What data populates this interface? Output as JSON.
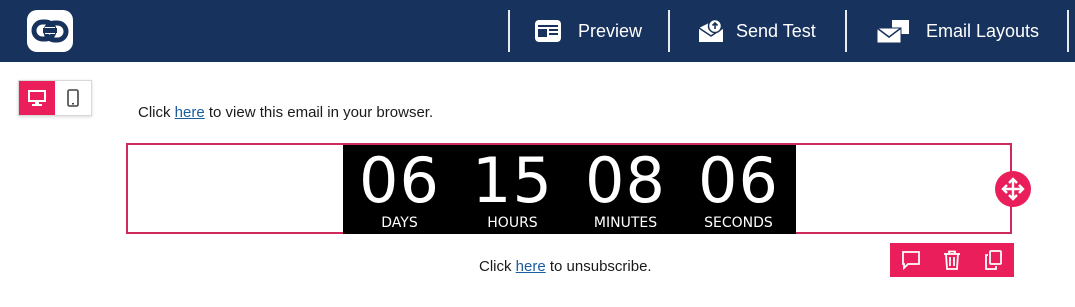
{
  "colors": {
    "header_bg": "#17325c",
    "accent": "#e91e5a",
    "link": "#1a5c9e",
    "timer_bg": "#000000"
  },
  "header": {
    "logo_icon": "link-chain-icon",
    "nav": [
      {
        "label": "Preview",
        "icon": "preview-window-icon"
      },
      {
        "label": "Send Test",
        "icon": "envelope-upload-icon"
      },
      {
        "label": "Email Layouts",
        "icon": "envelopes-icon"
      }
    ]
  },
  "device_toggle": {
    "desktop_icon": "desktop-monitor-icon",
    "mobile_icon": "mobile-phone-icon",
    "active": "desktop"
  },
  "email": {
    "view_in_browser": {
      "before": "Click ",
      "link": "here",
      "after": " to view this email in your browser."
    },
    "countdown": [
      {
        "value": "06",
        "label": "DAYS"
      },
      {
        "value": "15",
        "label": "HOURS"
      },
      {
        "value": "08",
        "label": "MINUTES"
      },
      {
        "value": "06",
        "label": "SECONDS"
      }
    ],
    "unsubscribe": {
      "before": "Click ",
      "link": "here",
      "after": " to unsubscribe."
    }
  },
  "block_actions": [
    "comment-icon",
    "trash-icon",
    "duplicate-icon"
  ],
  "move_handle_icon": "move-arrows-icon"
}
